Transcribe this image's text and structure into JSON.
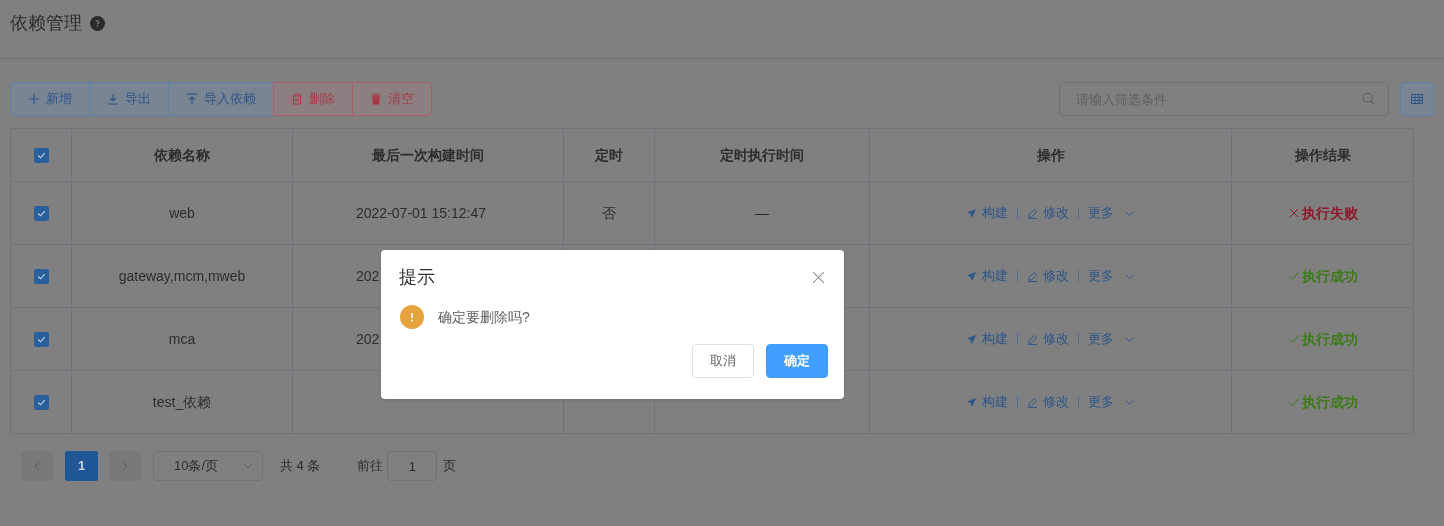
{
  "page_title": "依赖管理",
  "toolbar": [
    {
      "label": "新增",
      "kind": "add"
    },
    {
      "label": "导出",
      "kind": "export"
    },
    {
      "label": "导入依赖",
      "kind": "import"
    },
    {
      "label": "删除",
      "kind": "delete"
    },
    {
      "label": "清空",
      "kind": "clear"
    }
  ],
  "search": {
    "placeholder": "请输入筛选条件"
  },
  "table": {
    "select_all": {
      "checked": true
    },
    "columns": [
      "依赖名称",
      "最后一次构建时间",
      "定时",
      "定时执行时间",
      "操作",
      "操作结果"
    ],
    "rows": [
      {
        "checked": true,
        "name": "web",
        "last_build": "2022-07-01 15:12:47",
        "scheduled": "否",
        "schedule_time": "—",
        "actions": [
          "构建",
          "修改",
          "更多"
        ],
        "result": "执行失败",
        "kind": "fail"
      },
      {
        "checked": true,
        "name": "gateway,mcm,mweb",
        "last_build": "202",
        "actions": [
          "构建",
          "修改",
          "更多"
        ],
        "result": "执行成功",
        "kind": "success"
      },
      {
        "checked": true,
        "name": "mca",
        "last_build": "202",
        "actions": [
          "构建",
          "修改",
          "更多"
        ],
        "result": "执行成功",
        "kind": "success"
      },
      {
        "checked": true,
        "name": "test_依赖",
        "actions": [
          "构建",
          "修改",
          "更多"
        ],
        "result": "执行成功",
        "kind": "success"
      }
    ]
  },
  "pagination": {
    "pages": [
      {
        "label": "1",
        "selected": true
      }
    ],
    "page_size": "10条/页",
    "total": "共 4 条",
    "goto_label": "前往",
    "goto_value": "1",
    "goto_suffix": "页"
  },
  "dialog": {
    "title": "提示",
    "message": "确定要删除吗?",
    "buttons": [
      {
        "label": "取消",
        "kind": "secondary"
      },
      {
        "label": "确定",
        "kind": "primary"
      }
    ]
  }
}
